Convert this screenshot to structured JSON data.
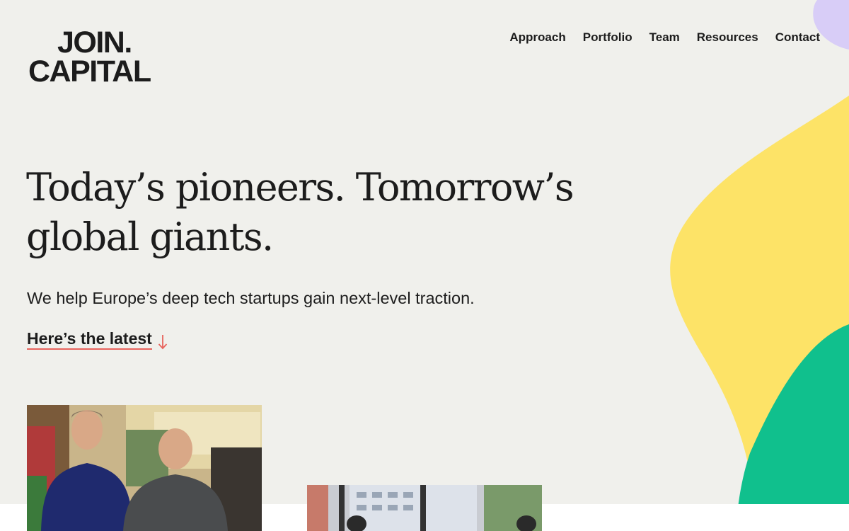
{
  "brand": {
    "line1": "JOIN.",
    "line2": "CAPITAL"
  },
  "nav": {
    "items": [
      {
        "label": "Approach"
      },
      {
        "label": "Portfolio"
      },
      {
        "label": "Team"
      },
      {
        "label": "Resources"
      },
      {
        "label": "Contact"
      }
    ]
  },
  "hero": {
    "title": "Today’s pioneers. Tomorrow’s global giants.",
    "subtitle": "We help Europe’s deep tech startups gain next-level traction.",
    "cta_label": "Here’s the latest",
    "cta_icon": "arrow-down-icon"
  },
  "colors": {
    "background": "#f0f0ec",
    "text": "#1c1c1c",
    "accent_underline": "#e8635c",
    "blob_yellow": "#fde367",
    "blob_green": "#10c08d",
    "blob_lavender": "#d8cdf7"
  }
}
